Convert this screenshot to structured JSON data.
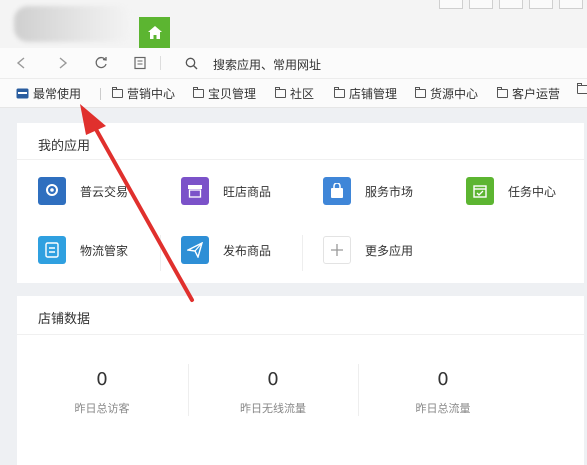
{
  "nav": {
    "address": "搜索应用、常用网址"
  },
  "bookmarks": [
    {
      "label": "最常使用"
    },
    {
      "label": "营销中心"
    },
    {
      "label": "宝贝管理"
    },
    {
      "label": "社区"
    },
    {
      "label": "店铺管理"
    },
    {
      "label": "货源中心"
    },
    {
      "label": "客户运营"
    }
  ],
  "my_apps": {
    "title": "我的应用",
    "items": [
      {
        "label": "普云交易",
        "icon": "puyun-icon",
        "color": "#2f6fbf"
      },
      {
        "label": "旺店商品",
        "icon": "shop-goods-icon",
        "color": "#7b52c9"
      },
      {
        "label": "服务市场",
        "icon": "bag-icon",
        "color": "#3f86d8"
      },
      {
        "label": "任务中心",
        "icon": "calendar-icon",
        "color": "#5cb531"
      },
      {
        "label": "物流管家",
        "icon": "logistics-icon",
        "color": "#2fa0e0"
      },
      {
        "label": "发布商品",
        "icon": "send-icon",
        "color": "#2e8fd6"
      },
      {
        "label": "更多应用",
        "icon": "plus-icon",
        "color": "#ffffff"
      }
    ]
  },
  "shop_data": {
    "title": "店铺数据",
    "stats": [
      {
        "value": "0",
        "label": "昨日总访客"
      },
      {
        "value": "0",
        "label": "昨日无线流量"
      },
      {
        "value": "0",
        "label": "昨日总流量"
      }
    ]
  },
  "colors": {
    "accent_green": "#5cb531",
    "arrow_red": "#e0302d"
  }
}
